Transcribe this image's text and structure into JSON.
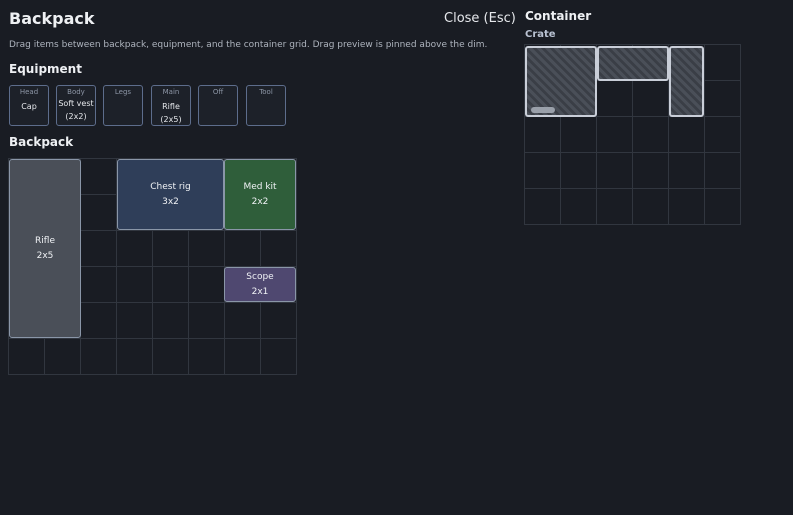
{
  "header": {
    "title": "Backpack",
    "close_label": "Close (Esc)"
  },
  "hint": "Drag items between backpack, equipment, and the container grid. Drag preview is pinned above the dim.",
  "equipment": {
    "heading": "Equipment",
    "slots": [
      {
        "label": "Head",
        "value": "Cap"
      },
      {
        "label": "Body",
        "value": "Soft vest\n(2x2)"
      },
      {
        "label": "Legs",
        "value": ""
      },
      {
        "label": "Main",
        "value": "Rifle (2x5)"
      },
      {
        "label": "Off",
        "value": ""
      },
      {
        "label": "Tool",
        "value": ""
      }
    ]
  },
  "backpack": {
    "heading": "Backpack",
    "grid": {
      "cols": 8,
      "rows": 6
    },
    "items": [
      {
        "name": "Rifle",
        "size": "2x5",
        "color": "#4a4f58"
      },
      {
        "name": "Chest rig",
        "size": "3x2",
        "color": "#2f3e59"
      },
      {
        "name": "Med kit",
        "size": "2x2",
        "color": "#2f5e3a"
      },
      {
        "name": "Scope",
        "size": "2x1",
        "color": "#4f4870"
      }
    ]
  },
  "container": {
    "heading": "Container",
    "name": "Crate",
    "grid": {
      "cols": 6,
      "rows": 5
    }
  }
}
